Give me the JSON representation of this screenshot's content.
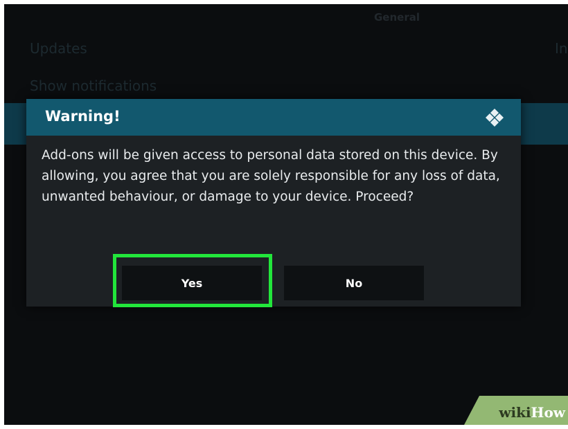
{
  "background": {
    "section_title": "General",
    "rows": [
      "Updates",
      "Show notifications"
    ],
    "right_partial": "In"
  },
  "dialog": {
    "title": "Warning!",
    "logo_icon": "kodi-logo-icon",
    "message": "Add-ons will be given access to personal data stored on this device. By allowing, you agree that you are solely responsible for any loss of data, unwanted behaviour, or damage to your device. Proceed?",
    "buttons": {
      "yes": "Yes",
      "no": "No"
    },
    "focused_button": "yes"
  },
  "watermark": {
    "part1": "wiki",
    "part2": "How"
  },
  "colors": {
    "header": "#12586e",
    "dialog_bg": "#1d2124",
    "button_bg": "#0e1113",
    "focus": "#22e63b"
  }
}
